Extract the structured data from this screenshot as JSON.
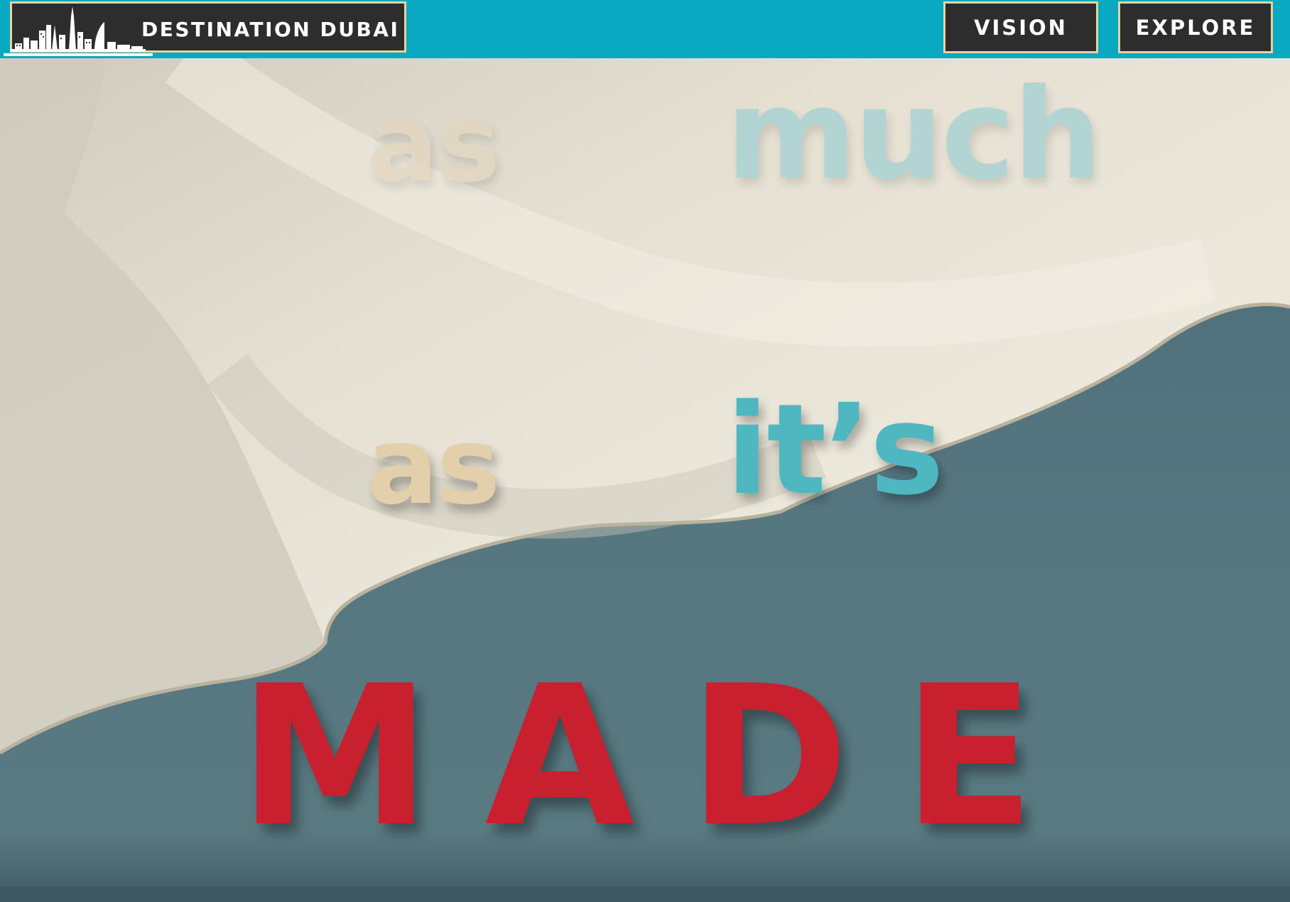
{
  "header": {
    "brand_label": "DESTINATION DUBAI",
    "nav": [
      {
        "label": "VISION"
      },
      {
        "label": "EXPLORE"
      }
    ]
  },
  "scene": {
    "words": {
      "as_top": "as",
      "much": "much",
      "as_bottom": "as",
      "its": "it’s",
      "made": "MADE"
    }
  },
  "colors": {
    "navbar": "#0aa9c2",
    "nav_button_bg": "#2d2d2d",
    "nav_button_border": "#e8d29f",
    "sand": "#e3cfaa",
    "teal_word": "#4fb7bf",
    "made_red": "#c8202e",
    "sea": "#4f6f7c"
  },
  "icons": {
    "brand": "dubai-skyline-icon"
  }
}
